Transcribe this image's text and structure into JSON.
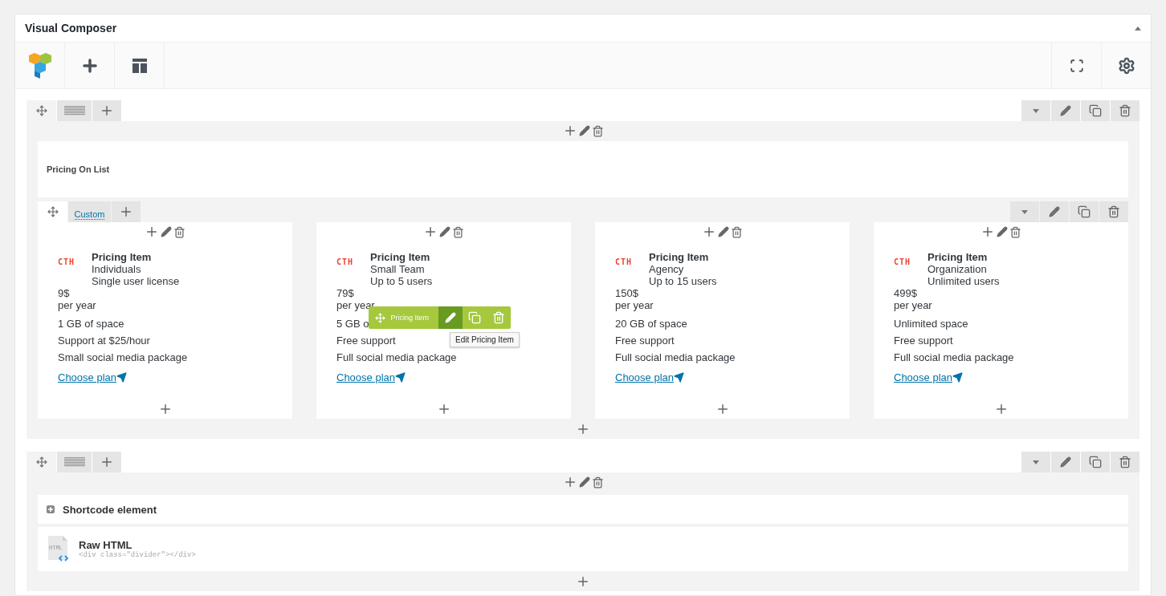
{
  "panel": {
    "title": "Visual Composer",
    "expanded": true
  },
  "rows": [
    {
      "kind": "pricing",
      "title": "Pricing On List",
      "inner_tab": "Custom",
      "columns": [
        {
          "logo": "CTH",
          "title": "Pricing Item",
          "subtitle": "Individuals",
          "description": "Single user license",
          "price": "9$",
          "period": "per year",
          "features": [
            "1 GB of space",
            "Support at $25/hour",
            "Small social media package"
          ],
          "link": "Choose plan"
        },
        {
          "logo": "CTH",
          "title": "Pricing Item",
          "subtitle": "Small Team",
          "description": "Up to 5 users",
          "price": "79$",
          "period": "per year",
          "features": [
            "5 GB o",
            "Free support",
            "Full social media package"
          ],
          "link": "Choose plan",
          "overlay": {
            "label": "Pricing Item",
            "tooltip": "Edit Pricing Item"
          }
        },
        {
          "logo": "CTH",
          "title": "Pricing Item",
          "subtitle": "Agency",
          "description": "Up to 15 users",
          "price": "150$",
          "period": "per year",
          "features": [
            "20 GB of space",
            "Free support",
            "Full social media package"
          ],
          "link": "Choose plan"
        },
        {
          "logo": "CTH",
          "title": "Pricing Item",
          "subtitle": "Organization",
          "description": "Unlimited users",
          "price": "499$",
          "period": "per year",
          "features": [
            "Unlimited space",
            "Free support",
            "Full social media package"
          ],
          "link": "Choose plan"
        }
      ]
    },
    {
      "kind": "elements",
      "elements": [
        {
          "kind": "shortcode",
          "title": "Shortcode element"
        },
        {
          "kind": "raw_html",
          "title": "Raw HTML",
          "code": "<div class=\"divider\"></div>",
          "icon_label": "HTML"
        }
      ]
    }
  ]
}
